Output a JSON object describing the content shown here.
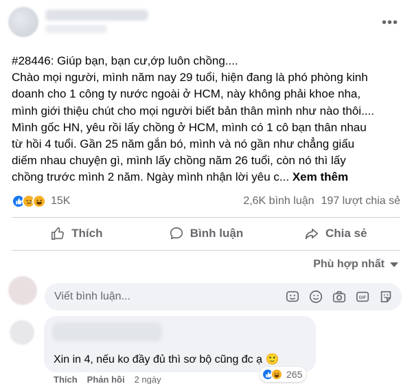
{
  "post": {
    "lines": [
      "#28446: Giúp bạn, bạn cư,ớp luôn chồng....",
      "Chào mọi người, mình năm nay 29 tuổi, hiện đang là phó phòng kinh",
      "doanh cho 1 công ty nước ngoài ở HCM, này không phải khoe nha,",
      "mình giới thiệu chút cho mọi người biết bản thân mình như nào thôi....",
      "Mình gốc HN, yêu rồi lấy chồng ở HCM, mình có 1 cô bạn thân nhau",
      "từ hồi 4 tuổi. Gần 25 năm gắn bó, mình và nó gần như chẳng giấu",
      "diếm nhau chuyện gì, mình lấy chồng năm 26 tuổi, còn nó thì lấy",
      "chồng trước mình 2 năm. Ngày mình nhận lời yêu c..."
    ],
    "see_more": "Xem thêm"
  },
  "reactions": {
    "count": "15K",
    "comments": "2,6K bình luận",
    "shares": "197 lượt chia sẻ",
    "icons": [
      "like-icon",
      "sad-icon",
      "haha-icon"
    ]
  },
  "actions": {
    "like": "Thích",
    "comment": "Bình luận",
    "share": "Chia sẻ"
  },
  "sort": {
    "label": "Phù hợp nhất"
  },
  "comment_input": {
    "placeholder": "Viết bình luận...",
    "icons": [
      "sticker-icon",
      "emoji-icon",
      "camera-icon",
      "gif-icon",
      "avatar-sticker-icon"
    ]
  },
  "comment": {
    "text": "Xin in 4, nếu ko đầy đủ thì sơ bộ cũng đc ạ 🙂",
    "reaction_count": "265",
    "like_label": "Thích",
    "reply_label": "Phản hồi",
    "time": "2 ngày"
  },
  "colors": {
    "accent": "#1877f2",
    "secondary_text": "#65676b",
    "input_bg": "#f0f2f5"
  }
}
